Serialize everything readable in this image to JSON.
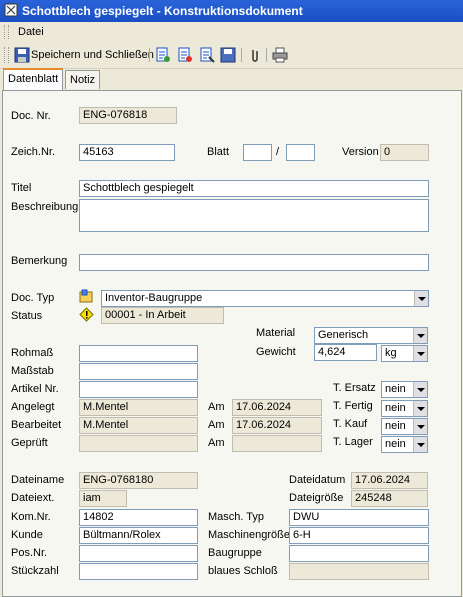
{
  "window": {
    "title": "Schottblech gespiegelt - Konstruktionsdokument"
  },
  "menu": {
    "file": "Datei"
  },
  "toolbar": {
    "save_close": "Speichern und Schließen"
  },
  "tabs": [
    "Datenblatt",
    "Notiz"
  ],
  "form": {
    "doc_nr_label": "Doc. Nr.",
    "doc_nr": "ENG-076818",
    "zeich_nr_label": "Zeich.Nr.",
    "zeich_nr": "45163",
    "blatt_label": "Blatt",
    "blatt_sep": "/",
    "blatt_a": "",
    "blatt_b": "",
    "version_label": "Version",
    "version": "0",
    "titel_label": "Titel",
    "titel": "Schottblech gespiegelt",
    "beschreibung_label": "Beschreibung",
    "beschreibung": "",
    "bemerkung_label": "Bemerkung",
    "bemerkung": "",
    "doc_typ_label": "Doc. Typ",
    "doc_typ": "Inventor-Baugruppe",
    "status_label": "Status",
    "status": "00001 - In Arbeit",
    "material_label": "Material",
    "material": "Generisch",
    "gewicht_label": "Gewicht",
    "gewicht": "4,624",
    "gewicht_unit": "kg",
    "rohmass_label": "Rohmaß",
    "masstab_label": "Maßstab",
    "artikel_label": "Artikel Nr.",
    "angelegt_label": "Angelegt",
    "angelegt_by": "M.Mentel",
    "bearbeitet_label": "Bearbeitet",
    "bearbeitet_by": "M.Mentel",
    "geprueft_label": "Geprüft",
    "am_label": "Am",
    "angelegt_am": "17.06.2024",
    "bearbeitet_am": "17.06.2024",
    "t_ersatz_label": "T. Ersatz",
    "t_fertig_label": "T. Fertig",
    "t_kauf_label": "T. Kauf",
    "t_lager_label": "T. Lager",
    "nein": "nein",
    "dateiname_label": "Dateiname",
    "dateiname": "ENG-0768180",
    "dateiext_label": "Dateiext.",
    "dateiext": "iam",
    "dateidatum_label": "Dateidatum",
    "dateidatum": "17.06.2024",
    "dateigroesse_label": "Dateigröße",
    "dateigroesse": "245248",
    "kom_nr_label": "Kom.Nr.",
    "kom_nr": "14802",
    "kunde_label": "Kunde",
    "kunde": "Bültmann/Rolex",
    "pos_nr_label": "Pos.Nr.",
    "stueckzahl_label": "Stückzahl",
    "masch_typ_label": "Masch. Typ",
    "masch_typ": "DWU",
    "maschinengroesse_label": "Maschinengröße",
    "maschinengroesse": "6-H",
    "baugruppe_label": "Baugruppe",
    "blaues_schloss_label": "blaues Schloß"
  },
  "colors": {
    "titlebar": "#2a63d9",
    "panel": "#f7f7f2",
    "tab_accent": "#e68b2c"
  }
}
